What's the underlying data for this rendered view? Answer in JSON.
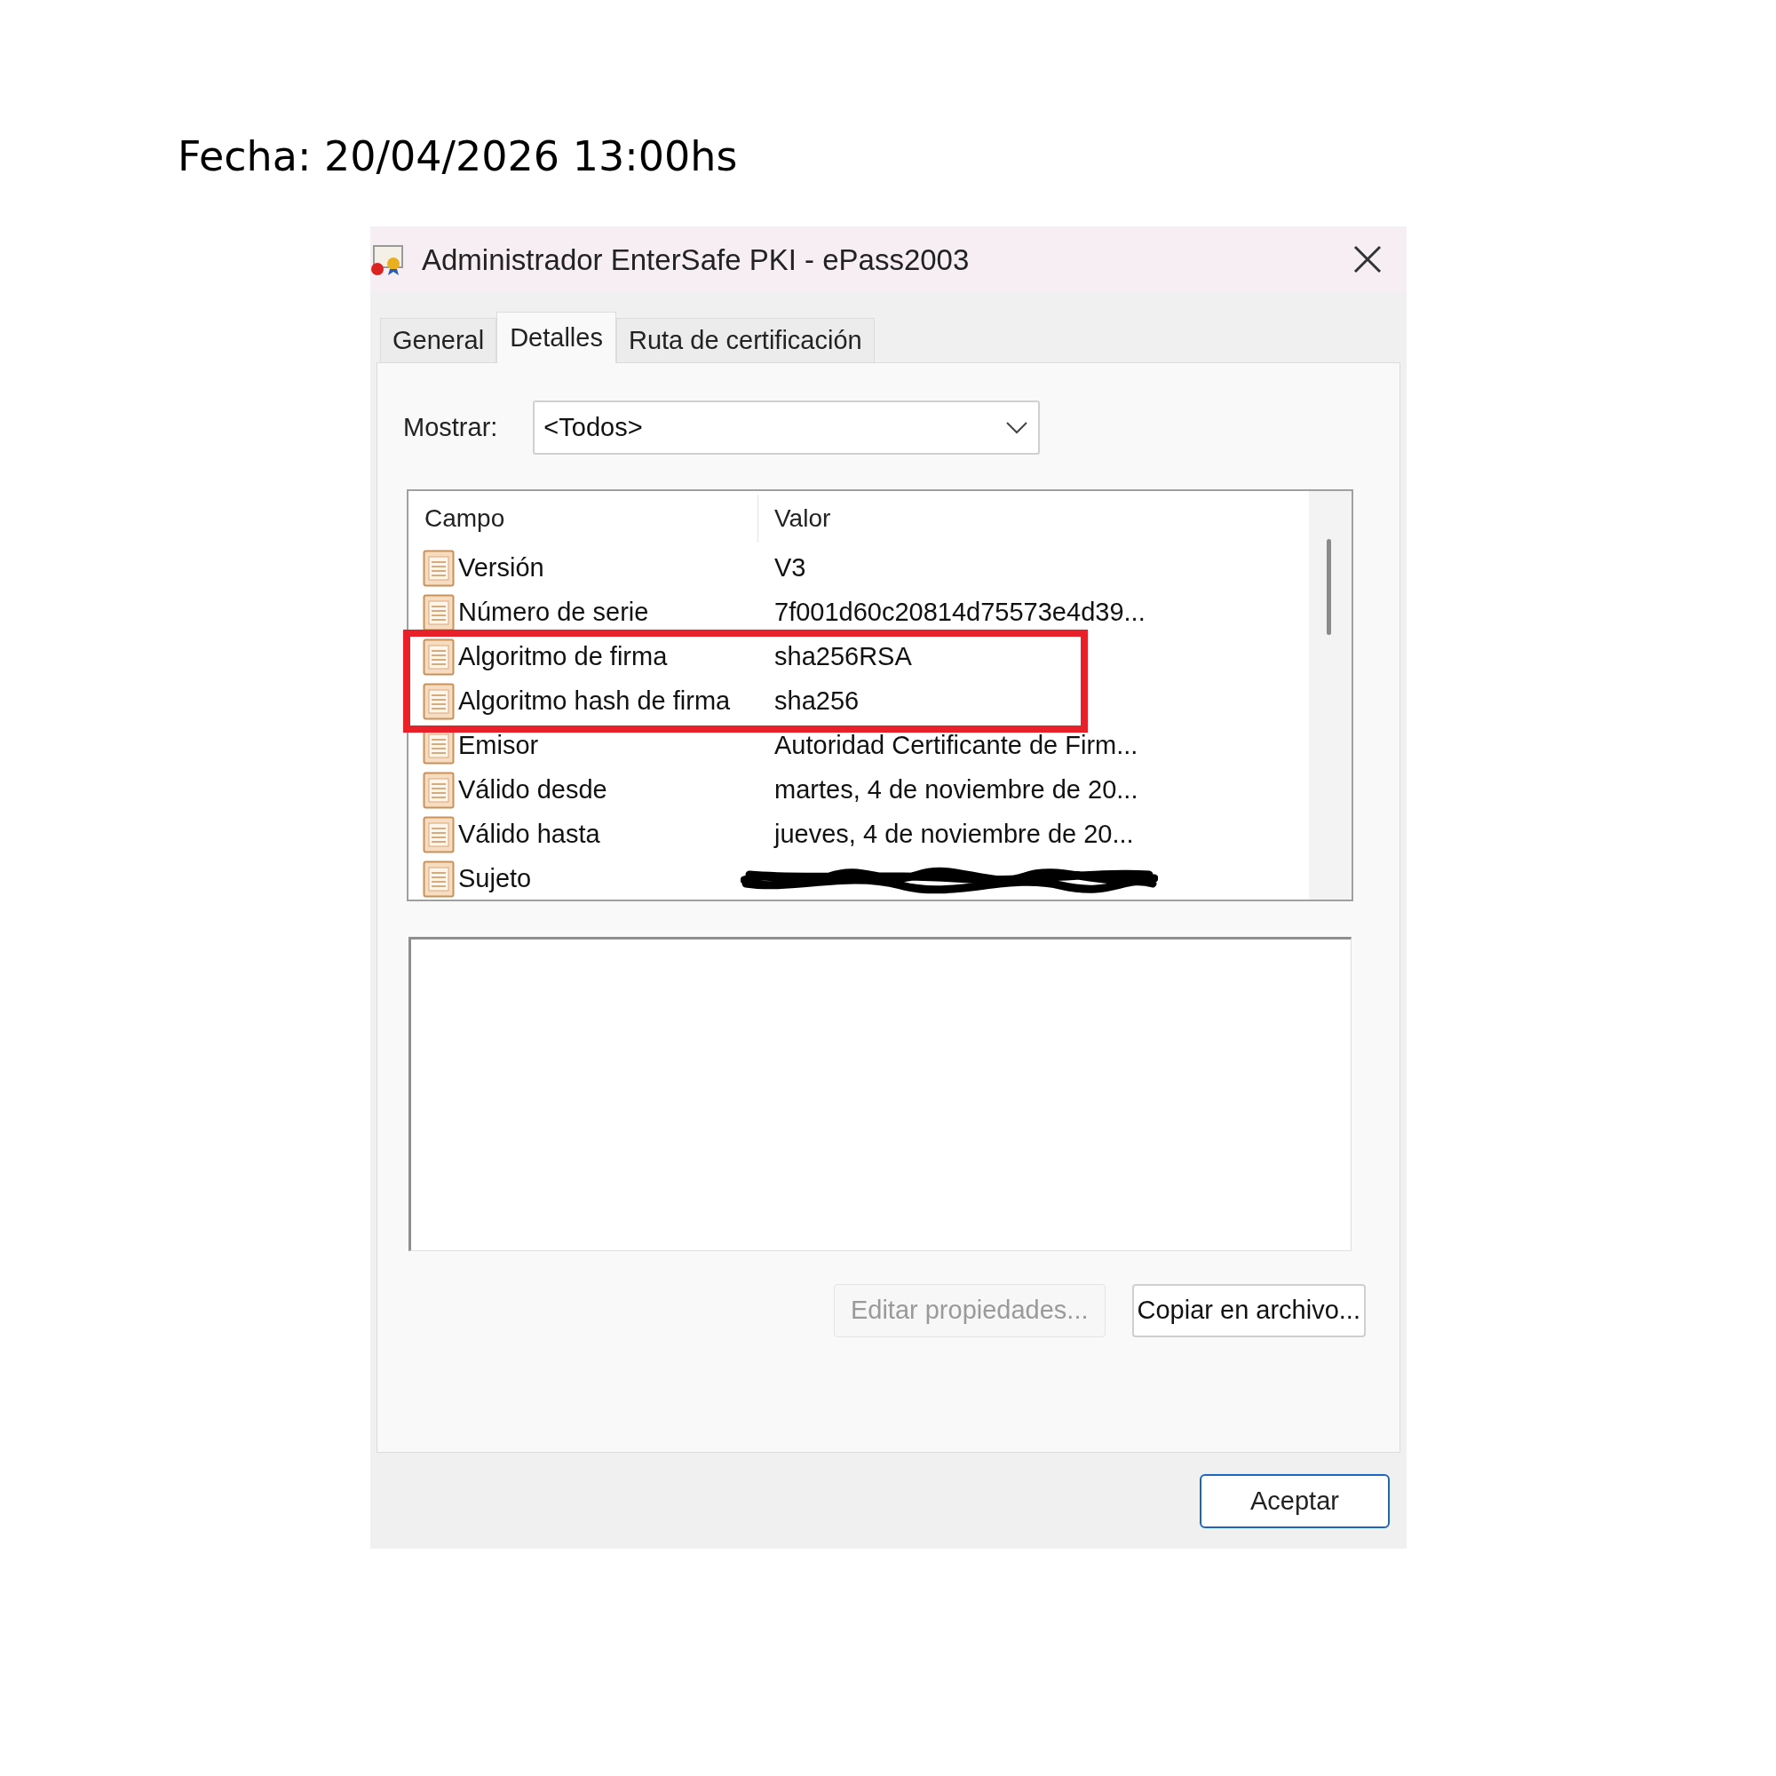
{
  "caption": "Fecha: 20/04/2026 13:00hs",
  "window": {
    "title": "Administrador EnterSafe PKI  - ePass2003"
  },
  "tabs": [
    {
      "label": "General",
      "selected": false
    },
    {
      "label": "Detalles",
      "selected": true
    },
    {
      "label": "Ruta de certificación",
      "selected": false
    }
  ],
  "show_filter": {
    "label": "Mostrar:",
    "value": "<Todos>"
  },
  "table": {
    "columns": [
      "Campo",
      "Valor"
    ],
    "rows": [
      {
        "field": "Versión",
        "value": "V3"
      },
      {
        "field": "Número de serie",
        "value": "7f001d60c20814d75573e4d39..."
      },
      {
        "field": "Algoritmo de firma",
        "value": "sha256RSA",
        "highlighted": true
      },
      {
        "field": "Algoritmo hash de firma",
        "value": "sha256",
        "highlighted": true
      },
      {
        "field": "Emisor",
        "value": "Autoridad Certificante de Firm..."
      },
      {
        "field": "Válido desde",
        "value": "martes, 4 de noviembre de 20..."
      },
      {
        "field": "Válido hasta",
        "value": "jueves, 4 de noviembre de 20..."
      },
      {
        "field": "Sujeto",
        "redacted": true
      }
    ]
  },
  "buttons": [
    {
      "label": "Editar propiedades...",
      "disabled": true
    },
    {
      "label": "Copiar en archivo...",
      "disabled": false
    }
  ],
  "footer_button": "Aceptar"
}
